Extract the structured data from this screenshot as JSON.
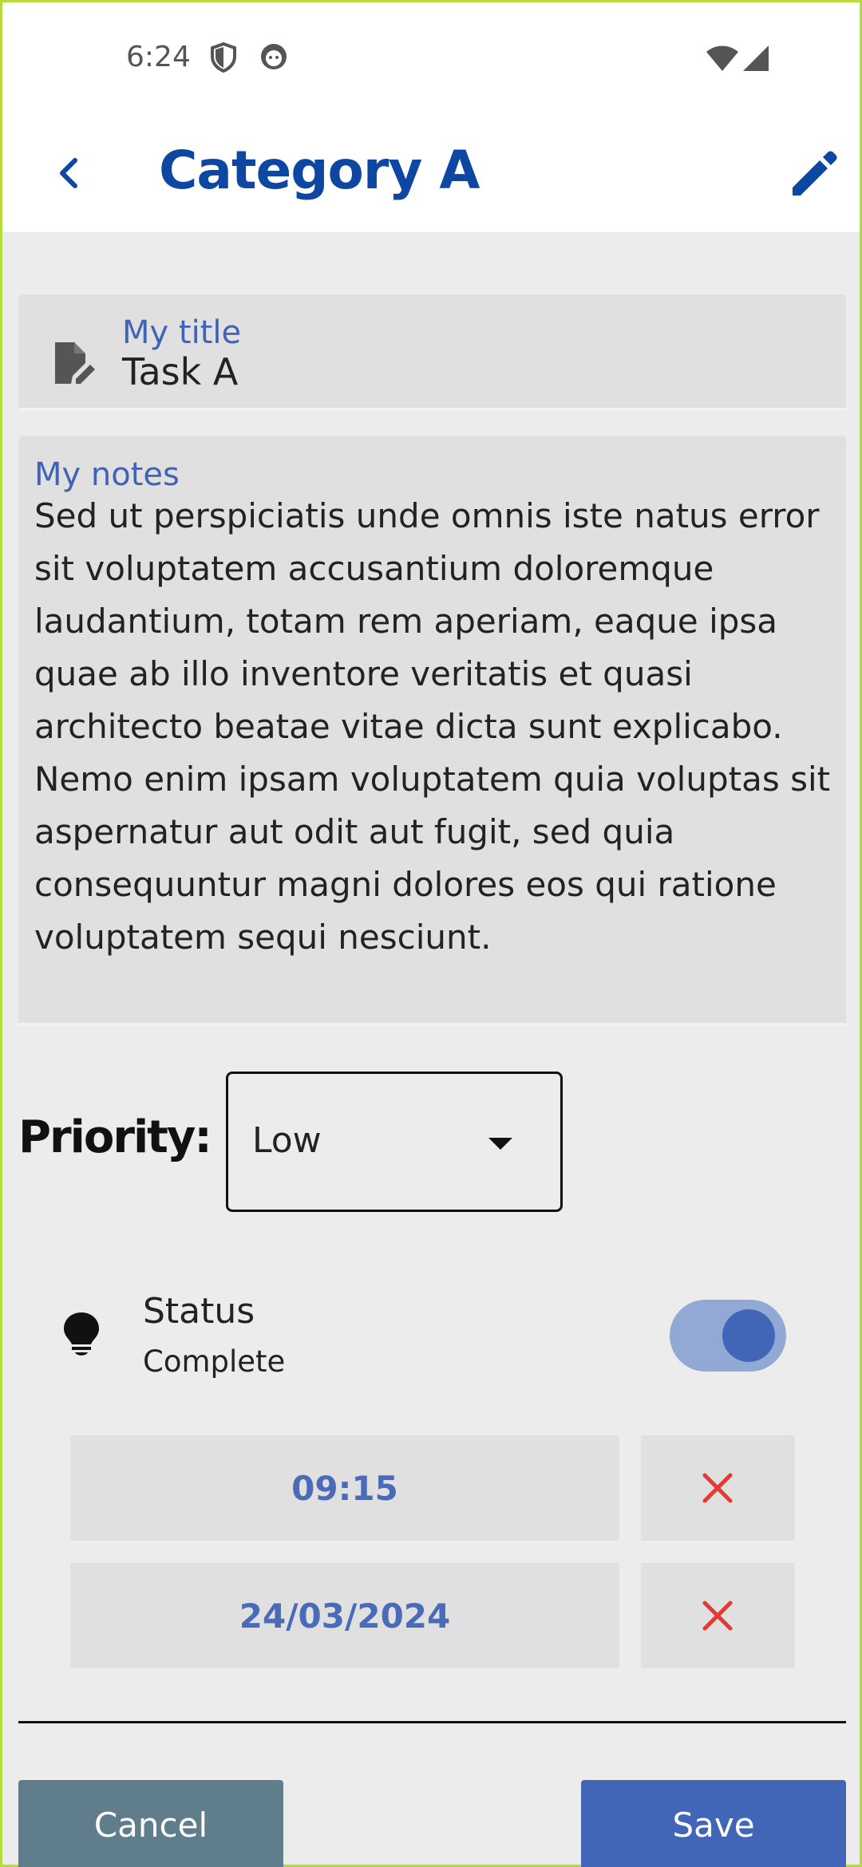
{
  "status_bar": {
    "time": "6:24",
    "icons": [
      "shield-icon",
      "face-icon",
      "wifi-icon",
      "signal-icon"
    ]
  },
  "app_bar": {
    "title": "Category A",
    "back_icon": "chevron-left-icon",
    "edit_icon": "pencil-icon",
    "accent_color": "#0d47a1"
  },
  "title_field": {
    "label": "My title",
    "value": "Task A",
    "icon": "document-edit-icon"
  },
  "notes_field": {
    "label": "My notes",
    "value": "Sed ut perspiciatis unde omnis iste natus error sit voluptatem accusantium doloremque laudantium, totam rem aperiam, eaque ipsa quae ab illo inventore veritatis et quasi architecto beatae vitae dicta sunt explicabo. Nemo enim ipsam voluptatem quia voluptas sit aspernatur aut odit aut fugit, sed quia consequuntur magni dolores eos qui ratione voluptatem sequi nesciunt."
  },
  "priority": {
    "label": "Priority:",
    "selected": "Low"
  },
  "status": {
    "title": "Status",
    "value": "Complete",
    "icon": "lightbulb-icon",
    "toggle_on": true
  },
  "time_field": {
    "value": "09:15"
  },
  "date_field": {
    "value": "24/03/2024"
  },
  "actions": {
    "cancel_label": "Cancel",
    "save_label": "Save",
    "cancel_color": "#607d8b",
    "save_color": "#4166b8",
    "clear_color": "#e53935"
  }
}
